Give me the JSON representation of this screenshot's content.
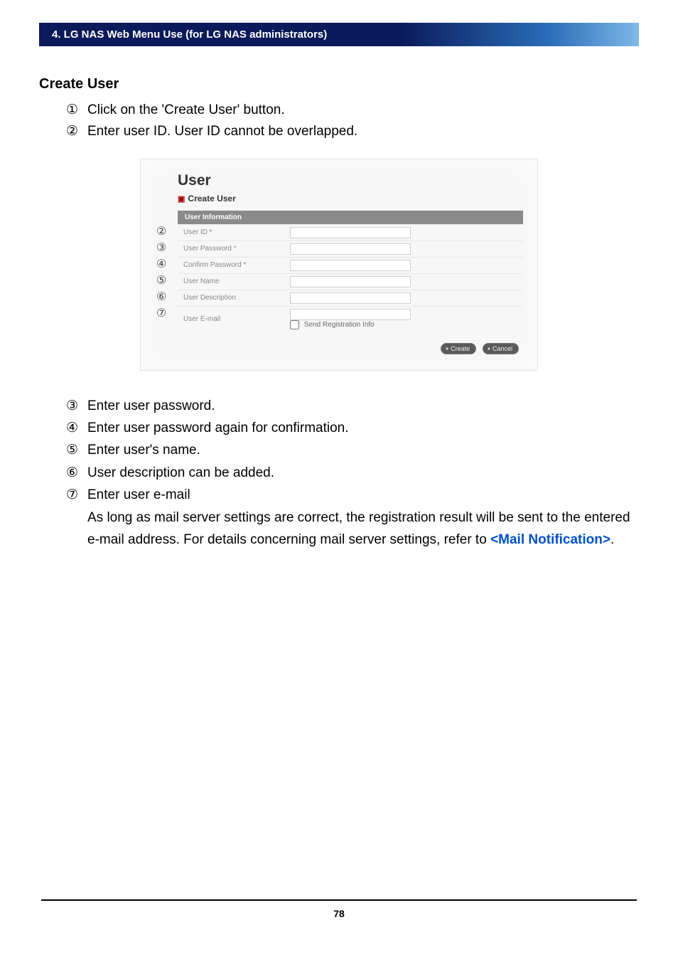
{
  "header": "4. LG NAS Web Menu Use (for LG NAS administrators)",
  "section_title": "Create User",
  "top_steps": [
    {
      "marker": "①",
      "text": "Click on the 'Create User' button."
    },
    {
      "marker": "②",
      "text": "Enter user ID. User ID cannot be overlapped."
    }
  ],
  "screenshot": {
    "title": "User",
    "breadcrumb": "Create User",
    "table_header": "User Information",
    "rows": [
      {
        "marker": "②",
        "label": "User ID *",
        "type": "text"
      },
      {
        "marker": "③",
        "label": "User Password *",
        "type": "text"
      },
      {
        "marker": "④",
        "label": "Confirm Password *",
        "type": "text"
      },
      {
        "marker": "⑤",
        "label": "User Name",
        "type": "text"
      },
      {
        "marker": "⑥",
        "label": "User Description",
        "type": "text"
      },
      {
        "marker": "⑦",
        "label": "User E-mail",
        "type": "email"
      }
    ],
    "checkbox_label": "Send Registration Info",
    "buttons": {
      "create": "Create",
      "cancel": "Cancel"
    }
  },
  "bottom_steps": [
    {
      "marker": "③",
      "text": "Enter user password."
    },
    {
      "marker": "④",
      "text": "Enter user password again for confirmation."
    },
    {
      "marker": "⑤",
      "text": "Enter user's name."
    },
    {
      "marker": "⑥",
      "text": "User description can be added."
    },
    {
      "marker": "⑦",
      "text": "Enter user e-mail"
    }
  ],
  "extra_paragraph": "As long as mail server settings are correct, the registration result will be sent to the entered e-mail address. For details concerning mail server settings, refer to ",
  "link_text": "<Mail Notification>",
  "period": ".",
  "page_number": "78"
}
